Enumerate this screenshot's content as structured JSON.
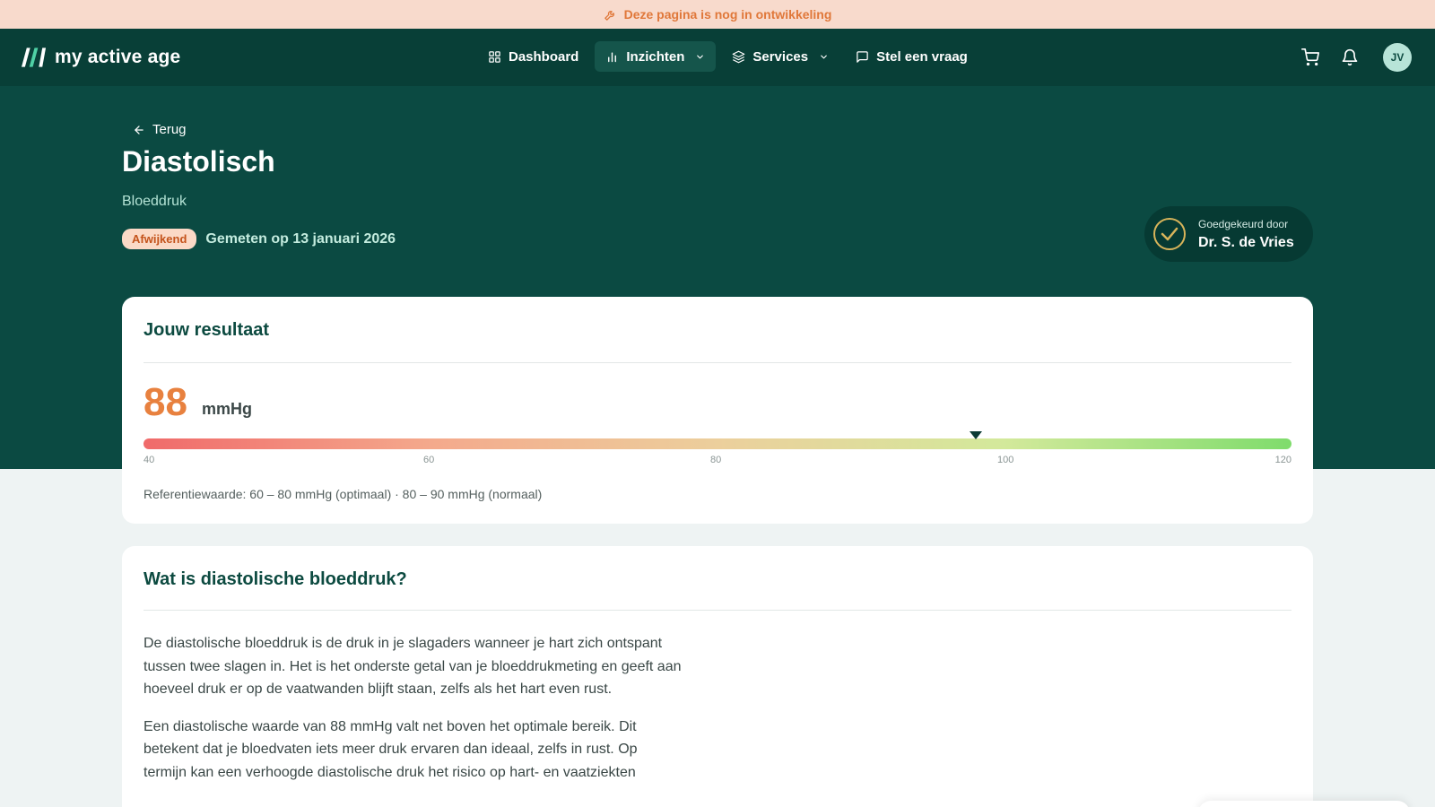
{
  "banner": {
    "icon": "wrench-icon",
    "text": "Deze pagina is nog in ontwikkeling",
    "color": "#e0783a"
  },
  "brand": {
    "name": "my active age"
  },
  "nav": {
    "items": [
      {
        "label": "Dashboard",
        "icon": "grid-icon"
      },
      {
        "label": "Inzichten",
        "icon": "bar-chart-icon",
        "active": true
      },
      {
        "label": "Services",
        "icon": "layers-icon"
      },
      {
        "label": "Stel een vraag",
        "icon": "chat-icon"
      }
    ],
    "cart_icon": "cart-icon",
    "bell_icon": "bell-icon",
    "avatar_initials": "JV"
  },
  "header": {
    "back_label": "Terug",
    "title": "Diastolisch",
    "category": "Bloeddruk",
    "status_badge": "Afwijkend",
    "measured_text": "Gemeten op 13 januari 2026",
    "approval": {
      "label": "Goedgekeurd door",
      "name": "Dr. S. de Vries"
    }
  },
  "result": {
    "card_title": "Jouw resultaat",
    "value": "88",
    "unit": "mmHg",
    "gauge": {
      "min": 40,
      "max": 120,
      "marker_value": 98,
      "ticks": [
        "40",
        "60",
        "80",
        "100",
        "120"
      ]
    },
    "reference": "Referentiewaarde: 60 – 80 mmHg (optimaal) · 80 – 90 mmHg (normaal)"
  },
  "info": {
    "card_title": "Wat is diastolische bloeddruk?",
    "paragraphs": [
      "De diastolische bloeddruk is de druk in je slagaders wanneer je hart zich ontspant tussen twee slagen in. Het is het onderste getal van je bloeddrukmeting en geeft aan hoeveel druk er op de vaatwanden blijft staan, zelfs als het hart even rust.",
      "Een diastolische waarde van 88 mmHg valt net boven het optimale bereik. Dit betekent dat je bloedvaten iets meer druk ervaren dan ideaal, zelfs in rust. Op termijn kan een verhoogde diastolische druk het risico op hart- en vaatziekten"
    ]
  },
  "colors": {
    "primary_dark": "#083f37",
    "hero": "#0b4a42",
    "accent_orange": "#e8813f",
    "badge_bg": "#fbd9c6"
  }
}
